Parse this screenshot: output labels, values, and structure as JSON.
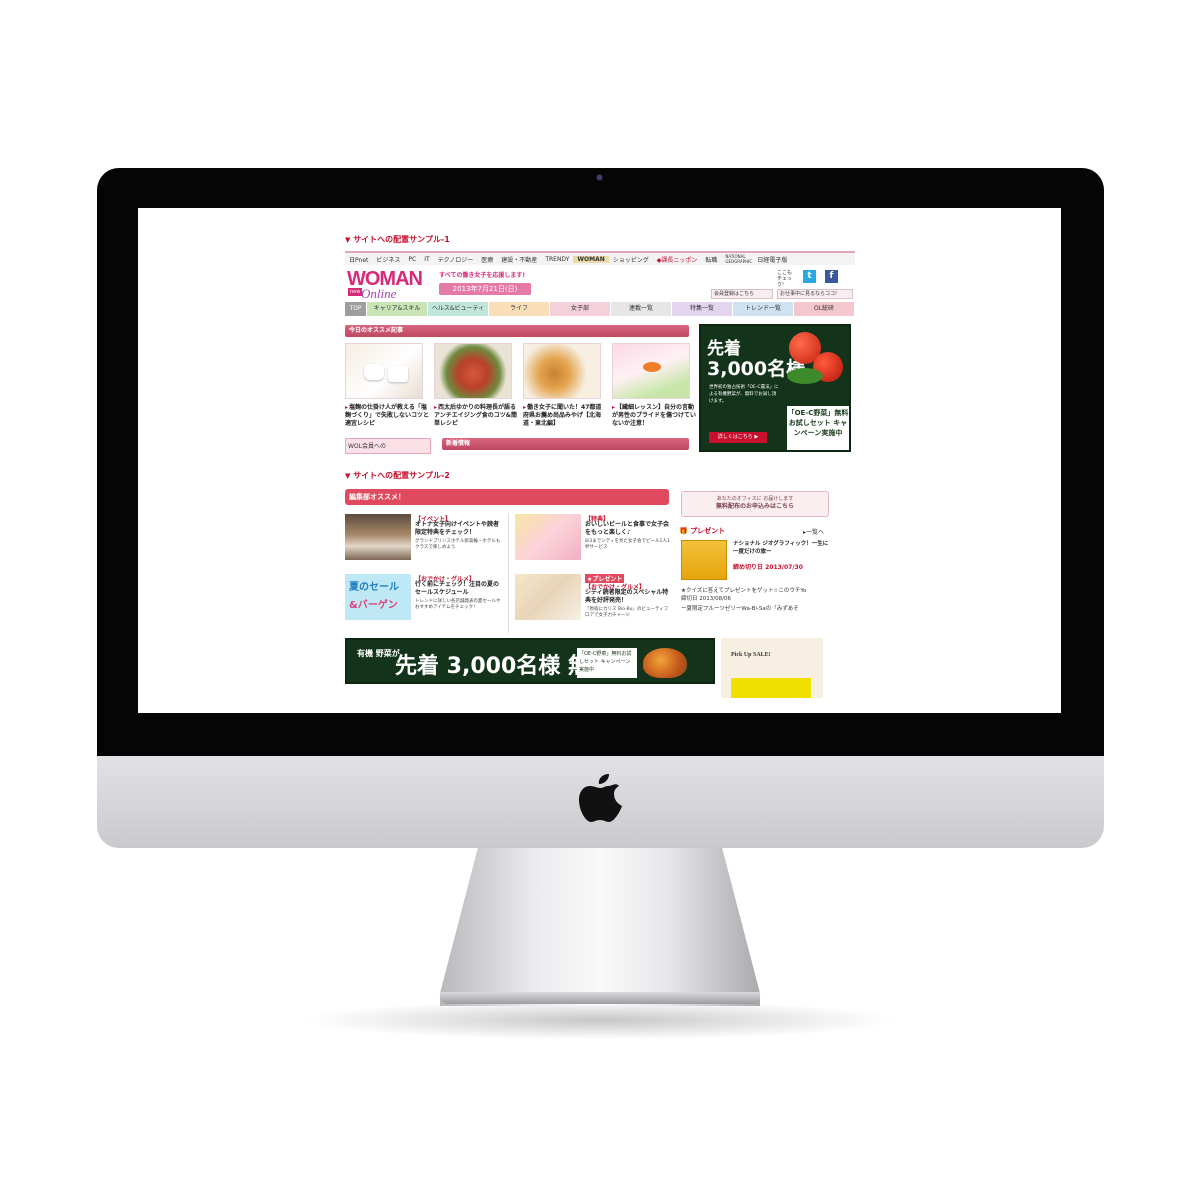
{
  "sample1": {
    "title": "サイトへの配置サンプル-1"
  },
  "sample2": {
    "title": "サイトへの配置サンプル-2"
  },
  "topnav": [
    "日Pnet",
    "ビジネス",
    "PC",
    "IT",
    "テクノロジー",
    "医療",
    "建設・不動産",
    "TRENDY",
    "WOMAN",
    "ショッピング",
    "◆課長ニッポン",
    "転職",
    "NATIONAL GEOGRAPHIC",
    "日経電子版"
  ],
  "header": {
    "logo_main": "WOMAN",
    "logo_sub": "Online",
    "logo_badge": "new",
    "tagline": "すべての働き女子を応援します!",
    "date": "2013年7月21日(日)",
    "check": "ここもチェック!",
    "twitter": "t",
    "facebook": "f",
    "member_link": "会員登録はこちら",
    "office_link": "お仕事中に見るならココ!"
  },
  "cattabs": [
    "TOP",
    "キャリア&スキル",
    "ヘルス&ビューティ",
    "ライフ",
    "女子部",
    "連載一覧",
    "特集一覧",
    "トレンド一覧",
    "OL総研"
  ],
  "recommend": {
    "title": "今日のオススメ記事",
    "items": [
      "塩麹の仕掛け人が教える「塩麹づくり」で失敗しないコツと適宜レシピ",
      "西太后ゆかりの料理長が語るアンチエイジング食のコツ&簡単レシピ",
      "働き女子に聞いた！47都道府県お薦め尚品みやげ【北海道・東北編】",
      "【繊細レッスン】自分の言動が男性のプライドを傷つけていないか注意！"
    ],
    "wol_banner": "WOL会員への",
    "news_title": "新着情報"
  },
  "ad1": {
    "line1": "先着",
    "line2": "3,000名様",
    "body": "世界初の独占技術「OE-C農法」による有機野菜が、無料でお試し頂けます。",
    "button": "詳しくはこちら ▶",
    "panel": "「OE-C野菜」無料お試しセット キャンペーン実施中"
  },
  "editor": {
    "title": "編集部オススメ！",
    "items": [
      {
        "tag": "【イベント】",
        "title": "オトナ女子向けイベントや読者限定特典をチェック！",
        "desc": "グランドプリンスホテル新高輪・ホテルもクラスで楽しめよう"
      },
      {
        "tag": "【特典】",
        "title": "おいしいビールと食事で女子会をもっと楽しく♪",
        "desc": "8/3までシティを見た女子会でビール1人1杯サービス"
      },
      {
        "tag": "【おでかけ・グルメ】",
        "title": "行く前にチェック！注目の夏のセールスケジュール",
        "desc": "トレンドに詳しい各店舗発表の夏セールやおすすめアイテムをチェック！"
      },
      {
        "tag": "【おでかけ・グルメ】",
        "title": "シティ読者限定のスペシャル特典を好評発売！",
        "desc": "「原宿にカリス Bio-Bu」のビューティフロアで女子力チャージ"
      }
    ],
    "summer_banner_1": "夏のセール",
    "summer_banner_2": "&バーゲン",
    "present_badge": "★プレゼント"
  },
  "side": {
    "office_line1": "あなたのオフィスに お届けします",
    "office_line2": "無料配布のお申込みはこちら",
    "present_title": "プレゼント",
    "present_all": "一覧へ",
    "present_item": "ナショナル ジオグラフィック！一生に一度だけの旅ー",
    "deadline": "締め切り日 2013/07/30",
    "list": [
      "★クイズに答えてプレゼントをゲット☆このウチYo",
      "締切日 2013/08/06",
      "ー夏限定フルーツゼリーWa-Bi-Saの「みずあそ"
    ]
  },
  "ad2": {
    "left": "有機 野菜が",
    "main": "先着 3,000名様 無料",
    "panel": "「OE-C野菜」無料お試しセット キャンペーン実施中"
  },
  "pickup": {
    "title": "Pick Up SALE!"
  },
  "colors": {
    "brand_pink": "#d62a78",
    "accent_red": "#c8102e",
    "ad_green": "#13341a"
  }
}
